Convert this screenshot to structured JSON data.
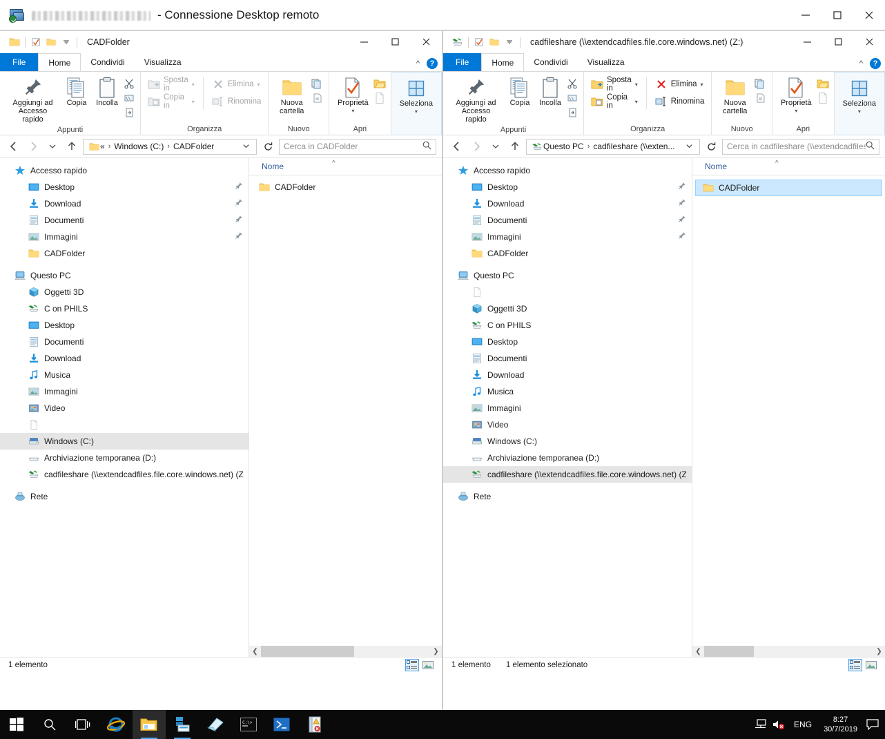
{
  "rdp": {
    "title_suffix": "- Connessione Desktop remoto",
    "host_redacted": "",
    "controls": {
      "minimize": "–",
      "maximize": "□",
      "close": "✕"
    }
  },
  "windows": [
    {
      "id": "left",
      "title": "CADFolder",
      "tabs": [
        {
          "label": "File",
          "active": false,
          "kind": "file"
        },
        {
          "label": "Home",
          "active": true,
          "kind": "normal"
        },
        {
          "label": "Condividi",
          "active": false,
          "kind": "normal"
        },
        {
          "label": "Visualizza",
          "active": false,
          "kind": "normal"
        }
      ],
      "ribbon": {
        "groups": [
          {
            "label": "Appunti",
            "big": [
              {
                "label": "Aggiungi ad Accesso rapido",
                "icon": "pin-icon",
                "disabled": false
              },
              {
                "label": "Copia",
                "icon": "copy-icon",
                "disabled": false
              },
              {
                "label": "Incolla",
                "icon": "paste-icon",
                "disabled": false
              }
            ],
            "mini": [
              "cut-icon",
              "copy-path-icon",
              "paste-shortcut-icon"
            ]
          },
          {
            "label": "Organizza",
            "small": [
              {
                "label": "Sposta in",
                "icon": "move-to-icon",
                "caret": true,
                "disabled": true
              },
              {
                "label": "Copia in",
                "icon": "copy-to-icon",
                "caret": true,
                "disabled": true
              },
              {
                "label": "Elimina",
                "icon": "delete-icon",
                "caret": true,
                "disabled": true
              },
              {
                "label": "Rinomina",
                "icon": "rename-icon",
                "caret": false,
                "disabled": true
              }
            ]
          },
          {
            "label": "Nuovo",
            "big": [
              {
                "label": "Nuova cartella",
                "icon": "new-folder-icon",
                "disabled": false
              }
            ],
            "mini": [
              "new-item-icon",
              "easy-access-icon"
            ]
          },
          {
            "label": "Apri",
            "big": [
              {
                "label": "Proprietà",
                "icon": "properties-icon",
                "caret": true,
                "disabled": false
              }
            ],
            "mini": [
              "open-icon",
              "edit-icon"
            ]
          },
          {
            "label": "",
            "selected_group": true,
            "big": [
              {
                "label": "Seleziona",
                "icon": "select-icon",
                "caret": true,
                "disabled": false
              }
            ]
          }
        ]
      },
      "address": {
        "back": "←",
        "forward": "→",
        "recent": "ˇ",
        "up": "↑",
        "icon": "folder-icon",
        "crumbs": [
          "«",
          "Windows (C:)",
          "CADFolder"
        ],
        "dropdown_caret": "ˇ",
        "refresh": "↻",
        "search_placeholder": "Cerca in CADFolder"
      },
      "nav_items": [
        {
          "label": "Accesso rapido",
          "icon": "star-icon",
          "indent": 0,
          "pin": false,
          "selected": false
        },
        {
          "label": "Desktop",
          "icon": "desktop-icon",
          "indent": 1,
          "pin": true,
          "selected": false
        },
        {
          "label": "Download",
          "icon": "download-icon",
          "indent": 1,
          "pin": true,
          "selected": false
        },
        {
          "label": "Documenti",
          "icon": "documents-icon",
          "indent": 1,
          "pin": true,
          "selected": false
        },
        {
          "label": "Immagini",
          "icon": "pictures-icon",
          "indent": 1,
          "pin": true,
          "selected": false
        },
        {
          "label": "CADFolder",
          "icon": "folder-icon",
          "indent": 1,
          "pin": false,
          "selected": false
        },
        {
          "label": "",
          "icon": "gap",
          "indent": 0,
          "pin": false,
          "selected": false
        },
        {
          "label": "Questo PC",
          "icon": "thispc-icon",
          "indent": 0,
          "pin": false,
          "selected": false
        },
        {
          "label": "Oggetti 3D",
          "icon": "objects3d-icon",
          "indent": 1,
          "pin": false,
          "selected": false
        },
        {
          "label": "C on PHILS",
          "icon": "netdrive-icon",
          "indent": 1,
          "pin": false,
          "selected": false
        },
        {
          "label": "Desktop",
          "icon": "desktop-icon",
          "indent": 1,
          "pin": false,
          "selected": false
        },
        {
          "label": "Documenti",
          "icon": "documents-icon",
          "indent": 1,
          "pin": false,
          "selected": false
        },
        {
          "label": "Download",
          "icon": "download-icon",
          "indent": 1,
          "pin": false,
          "selected": false
        },
        {
          "label": "Musica",
          "icon": "music-icon",
          "indent": 1,
          "pin": false,
          "selected": false
        },
        {
          "label": "Immagini",
          "icon": "pictures-icon",
          "indent": 1,
          "pin": false,
          "selected": false
        },
        {
          "label": "Video",
          "icon": "video-icon",
          "indent": 1,
          "pin": false,
          "selected": false
        },
        {
          "label": "",
          "icon": "blank-page-icon",
          "indent": 1,
          "pin": false,
          "selected": false
        },
        {
          "label": "Windows (C:)",
          "icon": "harddrive-icon",
          "indent": 1,
          "pin": false,
          "selected": true
        },
        {
          "label": "Archiviazione temporanea (D:)",
          "icon": "drive-icon",
          "indent": 1,
          "pin": false,
          "selected": false
        },
        {
          "label": "cadfileshare (\\\\extendcadfiles.file.core.windows.net) (Z:)",
          "icon": "netdrive-icon",
          "indent": 1,
          "pin": false,
          "selected": false
        },
        {
          "label": "",
          "icon": "gap",
          "indent": 0,
          "pin": false,
          "selected": false
        },
        {
          "label": "Rete",
          "icon": "network-icon",
          "indent": 0,
          "pin": false,
          "selected": false
        }
      ],
      "column_header": "Nome",
      "files": [
        {
          "label": "CADFolder",
          "icon": "folder-icon",
          "selected": false
        }
      ],
      "status": {
        "count": "1 elemento",
        "selection": ""
      }
    },
    {
      "id": "right",
      "title": "cadfileshare (\\\\extendcadfiles.file.core.windows.net) (Z:)",
      "tabs": [
        {
          "label": "File",
          "active": false,
          "kind": "file"
        },
        {
          "label": "Home",
          "active": true,
          "kind": "normal"
        },
        {
          "label": "Condividi",
          "active": false,
          "kind": "normal"
        },
        {
          "label": "Visualizza",
          "active": false,
          "kind": "normal"
        }
      ],
      "ribbon": {
        "groups": [
          {
            "label": "Appunti",
            "big": [
              {
                "label": "Aggiungi ad Accesso rapido",
                "icon": "pin-icon",
                "disabled": false
              },
              {
                "label": "Copia",
                "icon": "copy-icon",
                "disabled": false
              },
              {
                "label": "Incolla",
                "icon": "paste-icon",
                "disabled": false
              }
            ],
            "mini": [
              "cut-icon",
              "copy-path-icon",
              "paste-shortcut-icon"
            ]
          },
          {
            "label": "Organizza",
            "small": [
              {
                "label": "Sposta in",
                "icon": "move-to-icon",
                "caret": true,
                "disabled": false
              },
              {
                "label": "Copia in",
                "icon": "copy-to-icon",
                "caret": true,
                "disabled": false
              },
              {
                "label": "Elimina",
                "icon": "delete-icon",
                "caret": true,
                "disabled": false
              },
              {
                "label": "Rinomina",
                "icon": "rename-icon",
                "caret": false,
                "disabled": false
              }
            ]
          },
          {
            "label": "Nuovo",
            "big": [
              {
                "label": "Nuova cartella",
                "icon": "new-folder-icon",
                "disabled": false
              }
            ],
            "mini": [
              "new-item-icon",
              "easy-access-icon"
            ]
          },
          {
            "label": "Apri",
            "big": [
              {
                "label": "Proprietà",
                "icon": "properties-icon",
                "caret": true,
                "disabled": false
              }
            ],
            "mini": [
              "open-icon",
              "edit-icon"
            ]
          },
          {
            "label": "",
            "selected_group": true,
            "big": [
              {
                "label": "Seleziona",
                "icon": "select-icon",
                "caret": true,
                "disabled": false
              }
            ]
          }
        ]
      },
      "address": {
        "back": "←",
        "forward": "→",
        "recent": "ˇ",
        "up": "↑",
        "icon": "netdrive-icon",
        "crumbs": [
          "Questo PC",
          "cadfileshare (\\\\exten..."
        ],
        "dropdown_caret": "ˇ",
        "refresh": "↻",
        "search_placeholder": "Cerca in cadfileshare (\\\\extendcadfiles..."
      },
      "nav_items": [
        {
          "label": "Accesso rapido",
          "icon": "star-icon",
          "indent": 0,
          "pin": false,
          "selected": false
        },
        {
          "label": "Desktop",
          "icon": "desktop-icon",
          "indent": 1,
          "pin": true,
          "selected": false
        },
        {
          "label": "Download",
          "icon": "download-icon",
          "indent": 1,
          "pin": true,
          "selected": false
        },
        {
          "label": "Documenti",
          "icon": "documents-icon",
          "indent": 1,
          "pin": true,
          "selected": false
        },
        {
          "label": "Immagini",
          "icon": "pictures-icon",
          "indent": 1,
          "pin": true,
          "selected": false
        },
        {
          "label": "CADFolder",
          "icon": "folder-icon",
          "indent": 1,
          "pin": false,
          "selected": false
        },
        {
          "label": "",
          "icon": "gap",
          "indent": 0,
          "pin": false,
          "selected": false
        },
        {
          "label": "Questo PC",
          "icon": "thispc-icon",
          "indent": 0,
          "pin": false,
          "selected": false
        },
        {
          "label": "",
          "icon": "blank-page-icon",
          "indent": 1,
          "pin": false,
          "selected": false
        },
        {
          "label": "Oggetti 3D",
          "icon": "objects3d-icon",
          "indent": 1,
          "pin": false,
          "selected": false
        },
        {
          "label": "C on PHILS",
          "icon": "netdrive-icon",
          "indent": 1,
          "pin": false,
          "selected": false
        },
        {
          "label": "Desktop",
          "icon": "desktop-icon",
          "indent": 1,
          "pin": false,
          "selected": false
        },
        {
          "label": "Documenti",
          "icon": "documents-icon",
          "indent": 1,
          "pin": false,
          "selected": false
        },
        {
          "label": "Download",
          "icon": "download-icon",
          "indent": 1,
          "pin": false,
          "selected": false
        },
        {
          "label": "Musica",
          "icon": "music-icon",
          "indent": 1,
          "pin": false,
          "selected": false
        },
        {
          "label": "Immagini",
          "icon": "pictures-icon",
          "indent": 1,
          "pin": false,
          "selected": false
        },
        {
          "label": "Video",
          "icon": "video-icon",
          "indent": 1,
          "pin": false,
          "selected": false
        },
        {
          "label": "Windows (C:)",
          "icon": "harddrive-icon",
          "indent": 1,
          "pin": false,
          "selected": false
        },
        {
          "label": "Archiviazione temporanea (D:)",
          "icon": "drive-icon",
          "indent": 1,
          "pin": false,
          "selected": false
        },
        {
          "label": "cadfileshare (\\\\extendcadfiles.file.core.windows.net) (Z:)",
          "icon": "netdrive-icon",
          "indent": 1,
          "pin": false,
          "selected": true
        },
        {
          "label": "",
          "icon": "gap",
          "indent": 0,
          "pin": false,
          "selected": false
        },
        {
          "label": "Rete",
          "icon": "network-icon",
          "indent": 0,
          "pin": false,
          "selected": false
        }
      ],
      "column_header": "Nome",
      "files": [
        {
          "label": "CADFolder",
          "icon": "folder-icon",
          "selected": true
        }
      ],
      "status": {
        "count": "1 elemento",
        "selection": "1 elemento selezionato"
      }
    }
  ],
  "taskbar": {
    "items": [
      {
        "name": "start-button",
        "icon": "windows-logo-icon"
      },
      {
        "name": "search-button",
        "icon": "search-icon"
      },
      {
        "name": "task-view-button",
        "icon": "task-view-icon"
      },
      {
        "name": "internet-explorer-button",
        "icon": "internet-explorer-icon"
      },
      {
        "name": "file-explorer-button",
        "icon": "file-explorer-icon"
      },
      {
        "name": "server-manager-button",
        "icon": "server-manager-icon"
      },
      {
        "name": "notepad-button",
        "icon": "notepad-icon"
      },
      {
        "name": "command-prompt-button",
        "icon": "command-prompt-icon"
      },
      {
        "name": "powershell-button",
        "icon": "powershell-icon"
      },
      {
        "name": "event-viewer-button",
        "icon": "event-viewer-icon"
      }
    ],
    "tray": {
      "network_icon": "network-icon",
      "volume_icon": "volume-muted-icon",
      "language": "ENG",
      "time": "8:27",
      "date": "30/7/2019",
      "action_center_icon": "action-center-icon"
    }
  },
  "colors": {
    "accent": "#0078d7",
    "selection_fill": "#cce8ff",
    "selection_border": "#99d1ff",
    "nav_selection": "#e5e5e5",
    "folder_yellow": "#ffce5c",
    "taskbar": "#0a0a0a"
  }
}
